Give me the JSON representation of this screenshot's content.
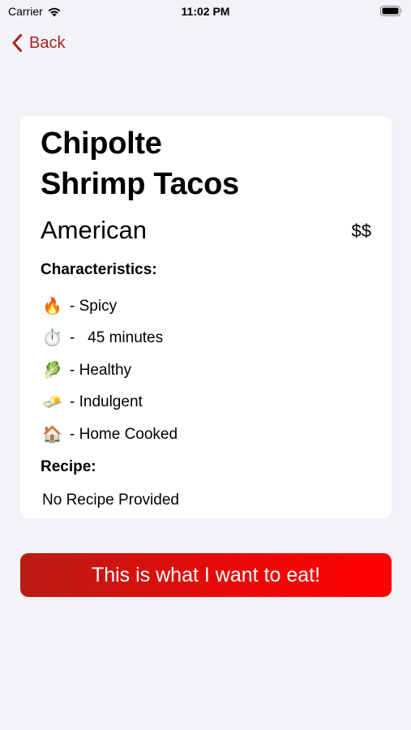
{
  "status_bar": {
    "carrier": "Carrier",
    "time": "11:02 PM"
  },
  "nav": {
    "back_label": "Back",
    "accent_color": "#a8241c"
  },
  "dish": {
    "title": "Chipolte\nShrimp Tacos",
    "cuisine": "American",
    "price": "$$"
  },
  "characteristics": {
    "heading": "Characteristics:",
    "items": [
      {
        "emoji": "🔥",
        "icon": "fire-icon",
        "label": "- Spicy"
      },
      {
        "emoji": "⏱️",
        "icon": "stopwatch-icon",
        "label": "-   45 minutes"
      },
      {
        "emoji": "🥬",
        "icon": "leafy-green-icon",
        "label": "- Healthy"
      },
      {
        "emoji": "🧈",
        "icon": "butter-icon",
        "label": "- Indulgent"
      },
      {
        "emoji": "🏠",
        "icon": "house-icon",
        "label": "- Home Cooked"
      }
    ]
  },
  "recipe": {
    "heading": "Recipe:",
    "text": "No Recipe Provided"
  },
  "cta": {
    "label": "This is what I want to eat!",
    "color": "#e80a0a"
  }
}
